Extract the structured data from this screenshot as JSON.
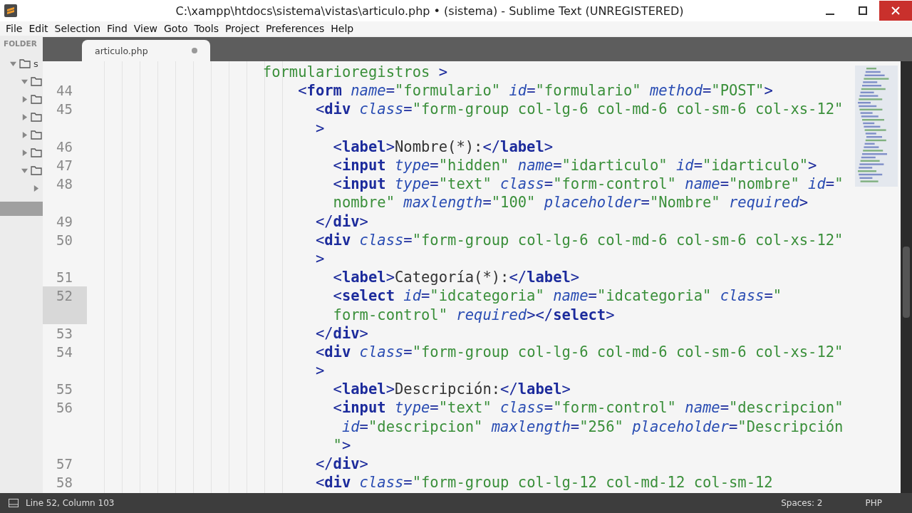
{
  "window": {
    "title": "C:\\xampp\\htdocs\\sistema\\vistas\\articulo.php • (sistema) - Sublime Text (UNREGISTERED)"
  },
  "menu": [
    "File",
    "Edit",
    "Selection",
    "Find",
    "View",
    "Goto",
    "Tools",
    "Project",
    "Preferences",
    "Help"
  ],
  "sidebar": {
    "header": "FOLDER",
    "items": [
      {
        "label": "s",
        "expanded": true,
        "children": [
          {
            "expanded": true
          },
          {
            "expanded": false
          },
          {
            "expanded": false
          },
          {
            "expanded": false
          },
          {
            "expanded": false
          },
          {
            "expanded": true,
            "children": [
              {
                "expanded": false
              }
            ]
          }
        ]
      }
    ]
  },
  "tabs": [
    {
      "label": "articulo.php",
      "selected": true,
      "modified": true
    }
  ],
  "lines": [
    {
      "rows": [
        {
          "segments": [
            {
              "kind": "str",
              "text": "                    formularioregistros"
            },
            {
              "kind": "p",
              "text": " >"
            }
          ]
        }
      ]
    },
    {
      "number": "44",
      "current": false,
      "rows": [
        {
          "segments": [
            {
              "kind": "p",
              "text": "                        <"
            },
            {
              "kind": "tag",
              "text": "form"
            },
            {
              "kind": "attr",
              "text": " name"
            },
            {
              "kind": "p",
              "text": "="
            },
            {
              "kind": "str",
              "text": "\"formulario\""
            },
            {
              "kind": "attr",
              "text": " id"
            },
            {
              "kind": "p",
              "text": "="
            },
            {
              "kind": "str",
              "text": "\"formulario\""
            },
            {
              "kind": "attr",
              "text": " method"
            },
            {
              "kind": "p",
              "text": "="
            },
            {
              "kind": "str",
              "text": "\"POST\""
            },
            {
              "kind": "p",
              "text": ">"
            }
          ]
        }
      ]
    },
    {
      "number": "45",
      "current": false,
      "rows": [
        {
          "segments": [
            {
              "kind": "p",
              "text": "                          <"
            },
            {
              "kind": "tag",
              "text": "div"
            },
            {
              "kind": "attr",
              "text": " class"
            },
            {
              "kind": "p",
              "text": "="
            },
            {
              "kind": "str",
              "text": "\"form-group col-lg-6 col-md-6 col-sm-6 col-xs-12\""
            }
          ]
        },
        {
          "segments": [
            {
              "kind": "p",
              "text": "                          >"
            }
          ]
        }
      ]
    },
    {
      "number": "46",
      "current": false,
      "rows": [
        {
          "segments": [
            {
              "kind": "p",
              "text": "                            <"
            },
            {
              "kind": "tag",
              "text": "label"
            },
            {
              "kind": "p",
              "text": ">"
            },
            {
              "kind": "txt",
              "text": "Nombre(*):"
            },
            {
              "kind": "p",
              "text": "</"
            },
            {
              "kind": "tag",
              "text": "label"
            },
            {
              "kind": "p",
              "text": ">"
            }
          ]
        }
      ]
    },
    {
      "number": "47",
      "current": false,
      "rows": [
        {
          "segments": [
            {
              "kind": "p",
              "text": "                            <"
            },
            {
              "kind": "tag",
              "text": "input"
            },
            {
              "kind": "attr",
              "text": " type"
            },
            {
              "kind": "p",
              "text": "="
            },
            {
              "kind": "str",
              "text": "\"hidden\""
            },
            {
              "kind": "attr",
              "text": " name"
            },
            {
              "kind": "p",
              "text": "="
            },
            {
              "kind": "str",
              "text": "\"idarticulo\""
            },
            {
              "kind": "attr",
              "text": " id"
            },
            {
              "kind": "p",
              "text": "="
            },
            {
              "kind": "str",
              "text": "\"idarticulo\""
            },
            {
              "kind": "p",
              "text": ">"
            }
          ]
        }
      ]
    },
    {
      "number": "48",
      "current": false,
      "rows": [
        {
          "segments": [
            {
              "kind": "p",
              "text": "                            <"
            },
            {
              "kind": "tag",
              "text": "input"
            },
            {
              "kind": "attr",
              "text": " type"
            },
            {
              "kind": "p",
              "text": "="
            },
            {
              "kind": "str",
              "text": "\"text\""
            },
            {
              "kind": "attr",
              "text": " class"
            },
            {
              "kind": "p",
              "text": "="
            },
            {
              "kind": "str",
              "text": "\"form-control\""
            },
            {
              "kind": "attr",
              "text": " name"
            },
            {
              "kind": "p",
              "text": "="
            },
            {
              "kind": "str",
              "text": "\"nombre\""
            },
            {
              "kind": "attr",
              "text": " id"
            },
            {
              "kind": "p",
              "text": "="
            },
            {
              "kind": "str",
              "text": "\""
            }
          ]
        },
        {
          "segments": [
            {
              "kind": "str",
              "text": "                            nombre\""
            },
            {
              "kind": "attr",
              "text": " maxlength"
            },
            {
              "kind": "p",
              "text": "="
            },
            {
              "kind": "str",
              "text": "\"100\""
            },
            {
              "kind": "attr",
              "text": " placeholder"
            },
            {
              "kind": "p",
              "text": "="
            },
            {
              "kind": "str",
              "text": "\"Nombre\""
            },
            {
              "kind": "attr",
              "text": " required"
            },
            {
              "kind": "p",
              "text": ">"
            }
          ]
        }
      ]
    },
    {
      "number": "49",
      "current": false,
      "rows": [
        {
          "segments": [
            {
              "kind": "p",
              "text": "                          </"
            },
            {
              "kind": "tag",
              "text": "div"
            },
            {
              "kind": "p",
              "text": ">"
            }
          ]
        }
      ]
    },
    {
      "number": "50",
      "current": false,
      "rows": [
        {
          "segments": [
            {
              "kind": "p",
              "text": "                          <"
            },
            {
              "kind": "tag",
              "text": "div"
            },
            {
              "kind": "attr",
              "text": " class"
            },
            {
              "kind": "p",
              "text": "="
            },
            {
              "kind": "str",
              "text": "\"form-group col-lg-6 col-md-6 col-sm-6 col-xs-12\""
            }
          ]
        },
        {
          "segments": [
            {
              "kind": "p",
              "text": "                          >"
            }
          ]
        }
      ]
    },
    {
      "number": "51",
      "current": false,
      "rows": [
        {
          "segments": [
            {
              "kind": "p",
              "text": "                            <"
            },
            {
              "kind": "tag",
              "text": "label"
            },
            {
              "kind": "p",
              "text": ">"
            },
            {
              "kind": "txt",
              "text": "Categoría(*):"
            },
            {
              "kind": "p",
              "text": "</"
            },
            {
              "kind": "tag",
              "text": "label"
            },
            {
              "kind": "p",
              "text": ">"
            }
          ]
        }
      ]
    },
    {
      "number": "52",
      "current": true,
      "rows": [
        {
          "segments": [
            {
              "kind": "p",
              "text": "                            <"
            },
            {
              "kind": "tag",
              "text": "select"
            },
            {
              "kind": "attr",
              "text": " id"
            },
            {
              "kind": "p",
              "text": "="
            },
            {
              "kind": "str",
              "text": "\"idcategoria\""
            },
            {
              "kind": "attr",
              "text": " name"
            },
            {
              "kind": "p",
              "text": "="
            },
            {
              "kind": "str",
              "text": "\"idcategoria\""
            },
            {
              "kind": "attr",
              "text": " class"
            },
            {
              "kind": "p",
              "text": "="
            },
            {
              "kind": "str",
              "text": "\""
            }
          ]
        },
        {
          "segments": [
            {
              "kind": "str",
              "text": "                            form-control\""
            },
            {
              "kind": "attr",
              "text": " required"
            },
            {
              "kind": "p",
              "text": "></"
            },
            {
              "kind": "tag",
              "text": "select"
            },
            {
              "kind": "p",
              "text": ">"
            }
          ]
        }
      ]
    },
    {
      "number": "53",
      "current": false,
      "rows": [
        {
          "segments": [
            {
              "kind": "p",
              "text": "                          </"
            },
            {
              "kind": "tag",
              "text": "div"
            },
            {
              "kind": "p",
              "text": ">"
            }
          ]
        }
      ]
    },
    {
      "number": "54",
      "current": false,
      "rows": [
        {
          "segments": [
            {
              "kind": "p",
              "text": "                          <"
            },
            {
              "kind": "tag",
              "text": "div"
            },
            {
              "kind": "attr",
              "text": " class"
            },
            {
              "kind": "p",
              "text": "="
            },
            {
              "kind": "str",
              "text": "\"form-group col-lg-6 col-md-6 col-sm-6 col-xs-12\""
            }
          ]
        },
        {
          "segments": [
            {
              "kind": "p",
              "text": "                          >"
            }
          ]
        }
      ]
    },
    {
      "number": "55",
      "current": false,
      "rows": [
        {
          "segments": [
            {
              "kind": "p",
              "text": "                            <"
            },
            {
              "kind": "tag",
              "text": "label"
            },
            {
              "kind": "p",
              "text": ">"
            },
            {
              "kind": "txt",
              "text": "Descripción:"
            },
            {
              "kind": "p",
              "text": "</"
            },
            {
              "kind": "tag",
              "text": "label"
            },
            {
              "kind": "p",
              "text": ">"
            }
          ]
        }
      ]
    },
    {
      "number": "56",
      "current": false,
      "rows": [
        {
          "segments": [
            {
              "kind": "p",
              "text": "                            <"
            },
            {
              "kind": "tag",
              "text": "input"
            },
            {
              "kind": "attr",
              "text": " type"
            },
            {
              "kind": "p",
              "text": "="
            },
            {
              "kind": "str",
              "text": "\"text\""
            },
            {
              "kind": "attr",
              "text": " class"
            },
            {
              "kind": "p",
              "text": "="
            },
            {
              "kind": "str",
              "text": "\"form-control\""
            },
            {
              "kind": "attr",
              "text": " name"
            },
            {
              "kind": "p",
              "text": "="
            },
            {
              "kind": "str",
              "text": "\"descripcion\""
            }
          ]
        },
        {
          "segments": [
            {
              "kind": "attr",
              "text": "                             id"
            },
            {
              "kind": "p",
              "text": "="
            },
            {
              "kind": "str",
              "text": "\"descripcion\""
            },
            {
              "kind": "attr",
              "text": " maxlength"
            },
            {
              "kind": "p",
              "text": "="
            },
            {
              "kind": "str",
              "text": "\"256\""
            },
            {
              "kind": "attr",
              "text": " placeholder"
            },
            {
              "kind": "p",
              "text": "="
            },
            {
              "kind": "str",
              "text": "\"Descripción"
            }
          ]
        },
        {
          "segments": [
            {
              "kind": "str",
              "text": "                            \""
            },
            {
              "kind": "p",
              "text": ">"
            }
          ]
        }
      ]
    },
    {
      "number": "57",
      "current": false,
      "rows": [
        {
          "segments": [
            {
              "kind": "p",
              "text": "                          </"
            },
            {
              "kind": "tag",
              "text": "div"
            },
            {
              "kind": "p",
              "text": ">"
            }
          ]
        }
      ]
    },
    {
      "number": "58",
      "current": false,
      "rows": [
        {
          "segments": [
            {
              "kind": "p",
              "text": "                          <"
            },
            {
              "kind": "tag",
              "text": "div"
            },
            {
              "kind": "attr",
              "text": " class"
            },
            {
              "kind": "p",
              "text": "="
            },
            {
              "kind": "str",
              "text": "\"form-group col-lg-12 col-md-12 col-sm-12"
            }
          ]
        }
      ]
    }
  ],
  "status_bar": {
    "position": "Line 52, Column 103",
    "indentation": "Spaces: 2",
    "syntax": "PHP"
  }
}
